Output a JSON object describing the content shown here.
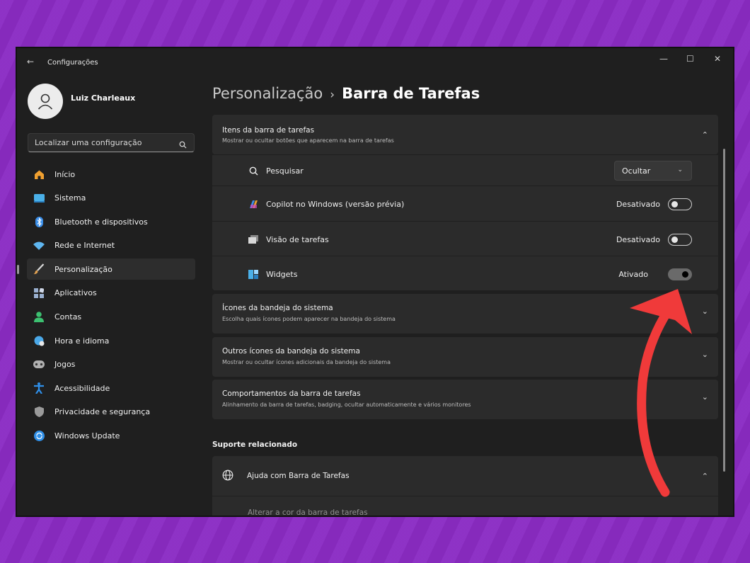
{
  "window": {
    "title": "Configurações",
    "back_glyph": "←",
    "minimize_glyph": "—",
    "maximize_glyph": "☐",
    "close_glyph": "✕"
  },
  "user": {
    "name": "Luiz Charleaux"
  },
  "search": {
    "placeholder": "Localizar uma configuração"
  },
  "sidebar": {
    "items": [
      {
        "label": "Início",
        "icon": "home-icon",
        "color": "#f0a030"
      },
      {
        "label": "Sistema",
        "icon": "system-icon",
        "color": "#4ab0e8"
      },
      {
        "label": "Bluetooth e dispositivos",
        "icon": "bluetooth-icon",
        "color": "#3a8ee8"
      },
      {
        "label": "Rede e Internet",
        "icon": "wifi-icon",
        "color": "#5fb6f0"
      },
      {
        "label": "Personalização",
        "icon": "brush-icon",
        "color": "#e0a050",
        "active": true
      },
      {
        "label": "Aplicativos",
        "icon": "apps-icon",
        "color": "#9ab0d0"
      },
      {
        "label": "Contas",
        "icon": "person-icon",
        "color": "#3cc070"
      },
      {
        "label": "Hora e idioma",
        "icon": "globe-clock-icon",
        "color": "#4aa8e8"
      },
      {
        "label": "Jogos",
        "icon": "gamepad-icon",
        "color": "#b0b0b0"
      },
      {
        "label": "Acessibilidade",
        "icon": "accessibility-icon",
        "color": "#2f8fe8"
      },
      {
        "label": "Privacidade e segurança",
        "icon": "shield-icon",
        "color": "#9a9a9a"
      },
      {
        "label": "Windows Update",
        "icon": "update-icon",
        "color": "#2f8fe8"
      }
    ]
  },
  "breadcrumb": {
    "parent": "Personalização",
    "separator": "›",
    "current": "Barra de Tarefas"
  },
  "taskbar_items": {
    "title": "Itens da barra de tarefas",
    "subtitle": "Mostrar ou ocultar botões que aparecem na barra de tarefas",
    "rows": [
      {
        "label": "Pesquisar",
        "control": "dropdown",
        "value": "Ocultar"
      },
      {
        "label": "Copilot no Windows (versão prévia)",
        "control": "toggle",
        "status": "Desativado",
        "on": false
      },
      {
        "label": "Visão de tarefas",
        "control": "toggle",
        "status": "Desativado",
        "on": false
      },
      {
        "label": "Widgets",
        "control": "toggle",
        "status": "Ativado",
        "on": true
      }
    ]
  },
  "tray_icons": {
    "title": "Ícones da bandeja do sistema",
    "subtitle": "Escolha quais ícones podem aparecer na bandeja do sistema"
  },
  "other_tray_icons": {
    "title": "Outros ícones da bandeja do sistema",
    "subtitle": "Mostrar ou ocultar ícones adicionais da bandeja do sistema"
  },
  "behaviors": {
    "title": "Comportamentos da barra de tarefas",
    "subtitle": "Alinhamento da barra de tarefas, badging, ocultar automaticamente e vários monitores"
  },
  "related_support": {
    "section_title": "Suporte relacionado",
    "help_title": "Ajuda com  Barra de Tarefas",
    "help_link": "Alterar a cor da barra de tarefas"
  },
  "glyphs": {
    "chevron_up": "⌃",
    "chevron_down": "⌄",
    "small_chevron": "⌄"
  },
  "colors": {
    "annotation_arrow": "#f03a3a",
    "background": "#8a2fc0"
  }
}
